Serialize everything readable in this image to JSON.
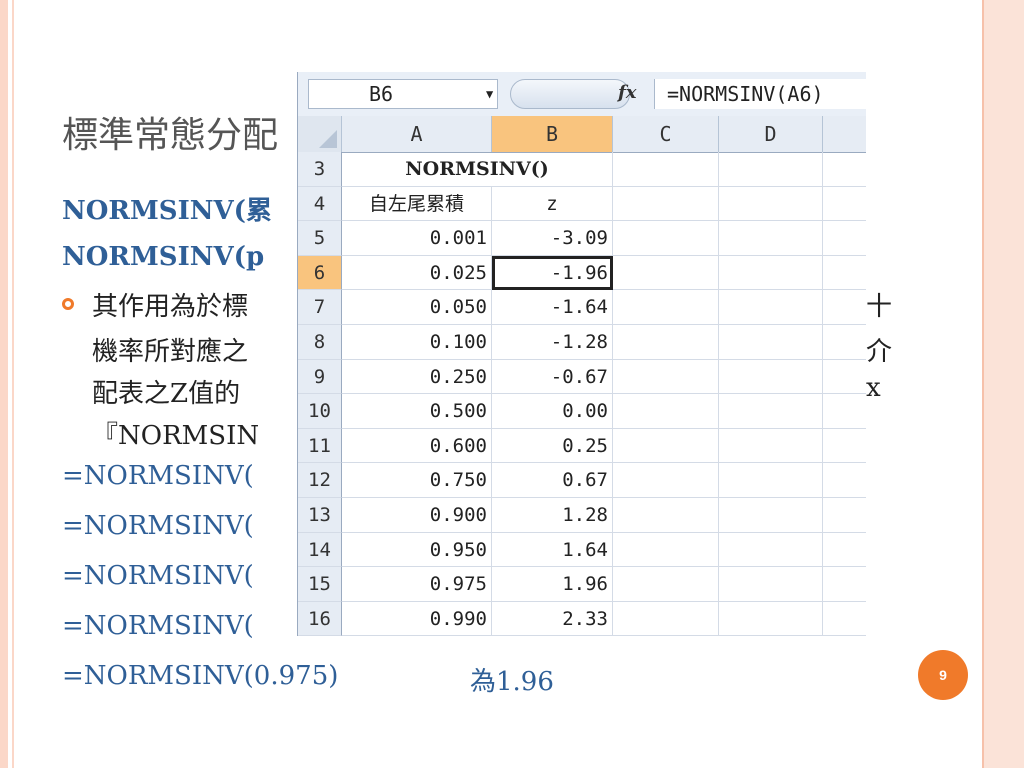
{
  "slide": {
    "title": "標準常態分配",
    "line1": "NORMSINV(累",
    "line2": "NORMSINV(p",
    "bullet_l1": "其作用為於標",
    "bullet_l1_tail": "十",
    "bullet_l2": "機率所對應之",
    "bullet_l2_tail": "介",
    "bullet_l3": "配表之Z值的",
    "bullet_l3_tail": "x",
    "bullet_l4": "『NORMSIN",
    "formula1": "=NORMSINV(",
    "formula2": "=NORMSINV(",
    "formula3": "=NORMSINV(",
    "formula4": "=NORMSINV(",
    "formula5": "=NORMSINV(0.975)",
    "formula5_result": "為1.96",
    "page_number": "9"
  },
  "spreadsheet": {
    "name_box": "B6",
    "fx_symbol": "fx",
    "formula": "=NORMSINV(A6)",
    "columns": [
      "A",
      "B",
      "C",
      "D"
    ],
    "rows": [
      {
        "num": "3",
        "a": "NORMSINV()",
        "b": "",
        "merged": true
      },
      {
        "num": "4",
        "a": "自左尾累積",
        "b": "z"
      },
      {
        "num": "5",
        "a": "0.001",
        "b": "-3.09"
      },
      {
        "num": "6",
        "a": "0.025",
        "b": "-1.96"
      },
      {
        "num": "7",
        "a": "0.050",
        "b": "-1.64"
      },
      {
        "num": "8",
        "a": "0.100",
        "b": "-1.28"
      },
      {
        "num": "9",
        "a": "0.250",
        "b": "-0.67"
      },
      {
        "num": "10",
        "a": "0.500",
        "b": "0.00"
      },
      {
        "num": "11",
        "a": "0.600",
        "b": "0.25"
      },
      {
        "num": "12",
        "a": "0.750",
        "b": "0.67"
      },
      {
        "num": "13",
        "a": "0.900",
        "b": "1.28"
      },
      {
        "num": "14",
        "a": "0.950",
        "b": "1.64"
      },
      {
        "num": "15",
        "a": "0.975",
        "b": "1.96"
      },
      {
        "num": "16",
        "a": "0.990",
        "b": "2.33"
      }
    ],
    "selected_row": "6",
    "selected_column": "B",
    "colors": {
      "selection_header": "#f9c47e",
      "header_bg": "#e6ecf4"
    }
  },
  "theme": {
    "accent": "#f07a2a",
    "text_blue": "#2f5f97"
  }
}
